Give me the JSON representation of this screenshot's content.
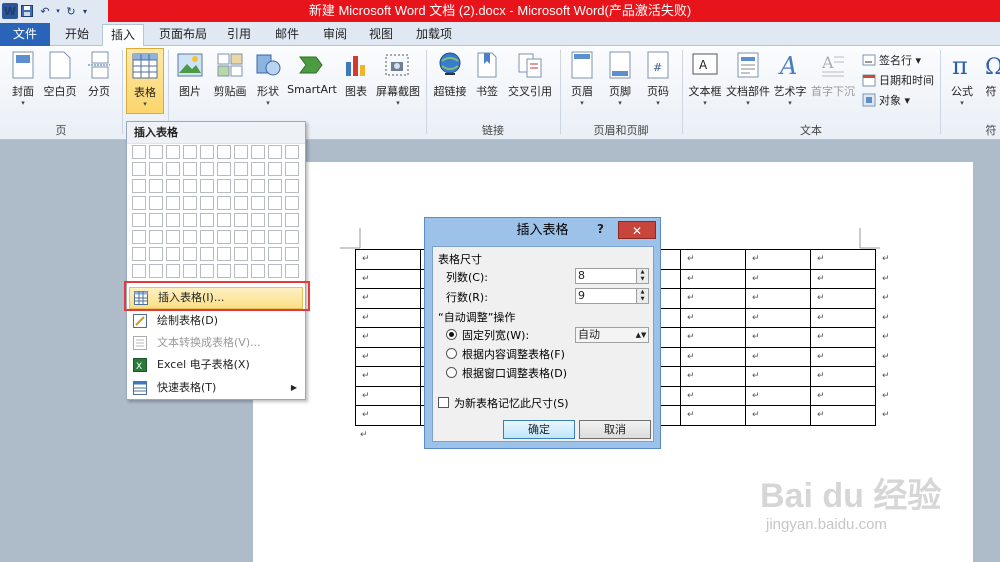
{
  "window": {
    "title": "新建 Microsoft Word 文档 (2).docx - Microsoft Word(产品激活失败)"
  },
  "qat": {
    "app_icon": "W",
    "save_icon": "save-icon",
    "undo_icon": "undo-icon",
    "redo_icon": "redo-icon"
  },
  "tabs": [
    {
      "label": "文件"
    },
    {
      "label": "开始"
    },
    {
      "label": "插入"
    },
    {
      "label": "页面布局"
    },
    {
      "label": "引用"
    },
    {
      "label": "邮件"
    },
    {
      "label": "审阅"
    },
    {
      "label": "视图"
    },
    {
      "label": "加载项"
    }
  ],
  "ribbon": {
    "page_group": {
      "label": "页",
      "cover": "封面",
      "blank": "空白页",
      "break": "分页"
    },
    "table_group": {
      "table": "表格"
    },
    "illus_group": {
      "picture": "图片",
      "clipart": "剪贴画",
      "shapes": "形状",
      "smartart": "SmartArt",
      "chart": "图表",
      "screenshot": "屏幕截图"
    },
    "links_group": {
      "label": "链接",
      "hyperlink": "超链接",
      "bookmark": "书签",
      "crossref": "交叉引用"
    },
    "hf_group": {
      "label": "页眉和页脚",
      "header": "页眉",
      "footer": "页脚",
      "pagenum": "页码"
    },
    "text_group": {
      "label": "文本",
      "textbox": "文本框",
      "quickparts": "文档部件",
      "wordart": "艺术字",
      "dropcap": "首字下沉",
      "sigline": "签名行 ▾",
      "datetime": "日期和时间",
      "object": "对象 ▾"
    },
    "symbols_group": {
      "label": "符",
      "equation": "公式",
      "symbol": "符"
    }
  },
  "dropdown": {
    "header": "插入表格",
    "items": [
      {
        "label": "插入表格(I)..."
      },
      {
        "label": "绘制表格(D)"
      },
      {
        "label": "文本转换成表格(V)..."
      },
      {
        "label": "Excel 电子表格(X)"
      },
      {
        "label": "快速表格(T)"
      }
    ]
  },
  "dialog": {
    "title": "插入表格",
    "help": "?",
    "close": "✕",
    "size_section": "表格尺寸",
    "cols_label": "列数(C):",
    "cols_value": "8",
    "rows_label": "行数(R):",
    "rows_value": "9",
    "autofit_section": "“自动调整”操作",
    "fixed_label": "固定列宽(W):",
    "fixed_value": "自动",
    "content_label": "根据内容调整表格(F)",
    "window_label": "根据窗口调整表格(D)",
    "remember_label": "为新表格记忆此尺寸(S)",
    "ok": "确定",
    "cancel": "取消"
  },
  "doc": {
    "para_mark": "↵",
    "rows": 9,
    "cols": 8
  },
  "watermark": {
    "brand": "Bai du 经验",
    "url": "jingyan.baidu.com"
  }
}
